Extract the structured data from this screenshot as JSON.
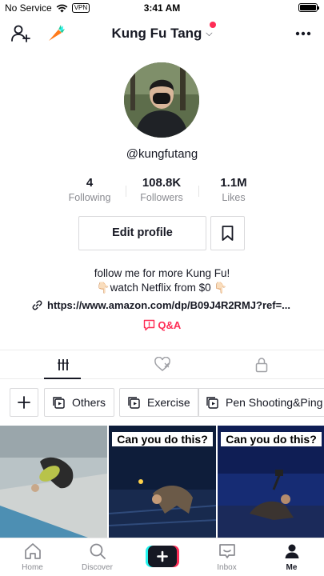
{
  "status": {
    "carrier": "No Service",
    "vpn": "VPN",
    "time": "3:41 AM"
  },
  "header": {
    "title": "Kung Fu Tang",
    "chevron": "⌵",
    "icons": [
      "add-user-icon",
      "carrot-icon",
      "more-icon"
    ]
  },
  "profile": {
    "handle": "@kungfutang",
    "stats": [
      {
        "value": "4",
        "label": "Following"
      },
      {
        "value": "108.8K",
        "label": "Followers"
      },
      {
        "value": "1.1M",
        "label": "Likes"
      }
    ],
    "edit_label": "Edit profile",
    "bio_line1": "follow me for more Kung Fu!",
    "bio_line2": "👇🏻watch Netflix from $0 👇🏻",
    "link": "https://www.amazon.com/dp/B09J4R2RMJ?ref=...",
    "qa_label": "Q&A"
  },
  "tabs": [
    "videos-grid-icon",
    "liked-icon",
    "lock-icon"
  ],
  "playlists": {
    "items": [
      {
        "label": "Others"
      },
      {
        "label": "Exercise"
      },
      {
        "label": "Pen Shooting&Ping Pong"
      }
    ]
  },
  "videos": [
    {
      "caption": ""
    },
    {
      "caption": "Can you do this?"
    },
    {
      "caption": "Can you do this?"
    }
  ],
  "bottom_nav": [
    {
      "label": "Home"
    },
    {
      "label": "Discover"
    },
    {
      "label": ""
    },
    {
      "label": "Inbox"
    },
    {
      "label": "Me"
    }
  ],
  "colors": {
    "accent": "#fe2c55",
    "text": "#161823",
    "muted": "#8a8b91",
    "create_cyan": "#25f4ee"
  }
}
